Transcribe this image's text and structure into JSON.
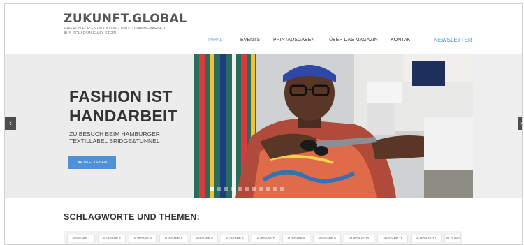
{
  "header": {
    "logo_title": "ZUKUNFT.GLOBAL",
    "logo_subtitle": "MAGAZIN FÜR ENTWICKLUNG UND ZUSAMMENARBEIT\nAUS SCHLESWIG-HOLSTEIN"
  },
  "nav": {
    "items": [
      {
        "label": "INHALT",
        "active": true
      },
      {
        "label": "EVENTS"
      },
      {
        "label": "PRINTAUSGABEN"
      },
      {
        "label": "ÜBER DAS MAGAZIN"
      },
      {
        "label": "KONTAKT"
      },
      {
        "label": "NEWSLETTER",
        "highlight": true
      }
    ]
  },
  "hero": {
    "headline": "FASHION IST\nHANDARBEIT",
    "subline": "ZU BESUCH BEIM HAMBURGER\nTEXTILLABEL BRIDGE&TUNNEL",
    "button_label": "ARTIKEL LESEN",
    "prev_arrow": "‹",
    "next_arrow": "›",
    "slide_count": 11,
    "active_slide": 0
  },
  "tags": {
    "title": "SCHLAGWORTE UND THEMEN:",
    "items": [
      "AUSGABE 1",
      "AUSGABE 2",
      "AUSGABE 3",
      "AUSGABE 4",
      "AUSGABE 5",
      "AUSGABE 6",
      "AUSGABE 7",
      "AUSGABE 8",
      "AUSGABE 9",
      "AUSGABE 10",
      "AUSGABE 11",
      "AUSGABE 12",
      "BILDUNG"
    ]
  },
  "colors": {
    "accent": "#4f93d6",
    "nav_active": "#78a8d6",
    "text_dark": "#333333"
  }
}
